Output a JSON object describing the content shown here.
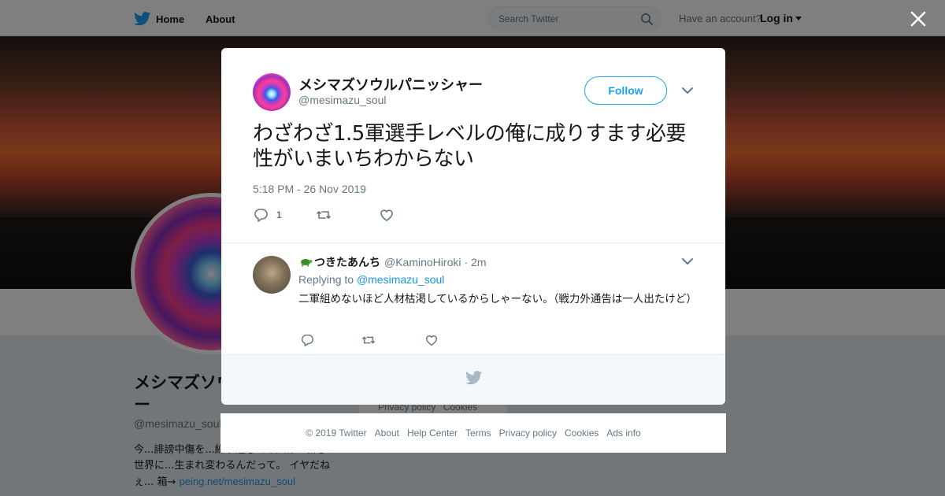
{
  "topbar": {
    "home_label": "Home",
    "about_label": "About",
    "search_placeholder": "Search Twitter",
    "have_account": "Have an account?",
    "login_label": "Log in"
  },
  "profile": {
    "name": "メシマズソウルパニッシャー",
    "handle": "@mesimazu_soul",
    "bio_text": "今...誹謗中傷を...繰り返してる人は...新しい世界に...生まれ変わるんだって。 イヤだねぇ... 箱→ ",
    "bio_link": "peing.net/mesimazu_soul"
  },
  "side_links": [
    "Privacy policy",
    "Cookies"
  ],
  "tweet": {
    "author_name": "メシマズソウルパニッシャー",
    "author_handle": "@mesimazu_soul",
    "follow_label": "Follow",
    "text": "わざわざ1.5軍選手レベルの俺に成りすます必要性がいまいちわからない",
    "timestamp": "5:18 PM - 26 Nov 2019",
    "reply_count": "1"
  },
  "reply": {
    "author_name": "つきたあんち",
    "author_handle": "@KaminoHiroki",
    "separator": "·",
    "time": "2m",
    "replying_prefix": "Replying to",
    "replying_mention": "@mesimazu_soul",
    "text": "二軍組めないほど人材枯渇しているからしゃーない。（戦力外通告は一人出たけど）"
  },
  "footer_links": [
    "© 2019 Twitter",
    "About",
    "Help Center",
    "Terms",
    "Privacy policy",
    "Cookies",
    "Ads info"
  ],
  "colors": {
    "accent": "#1da1f2",
    "link": "#1b95e0",
    "muted": "#657786",
    "text": "#14171a"
  },
  "icons": [
    "twitter-bird-icon",
    "search-icon",
    "close-icon",
    "chevron-down-icon",
    "reply-icon",
    "retweet-icon",
    "like-icon",
    "turtle-emoji-icon"
  ]
}
